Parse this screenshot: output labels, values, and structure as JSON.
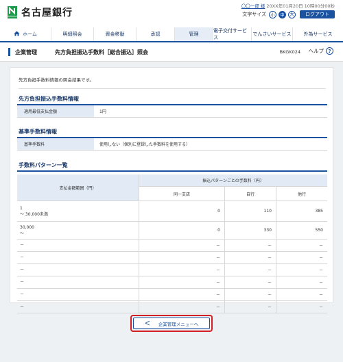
{
  "header": {
    "bank_name": "名古屋銀行",
    "user_name": "〇〇一郎 様",
    "login_datetime": "20XX年01月20日 10時00分00秒",
    "font_size_label": "文字サイズ",
    "font_sizes": [
      "小",
      "中",
      "大"
    ],
    "logout_label": "ログアウト"
  },
  "nav": {
    "items": [
      "ホーム",
      "明細照会",
      "資金移動",
      "承認",
      "管理",
      "電子交付サービス",
      "でんさいサービス",
      "外為サービス"
    ],
    "active": "管理"
  },
  "title": {
    "category": "企業管理",
    "main": "先方負担振込手数料［総合振込］照会",
    "screen_id": "BKGK024",
    "help_label": "ヘルプ",
    "help_icon_glyph": "?"
  },
  "intro_text": "先方負担手数料情報の照会結果です。",
  "section1": {
    "heading": "先方負担振込手数料情報",
    "key": "適用最低支払金額",
    "value": "1円"
  },
  "section2": {
    "heading": "基準手数料情報",
    "key": "基準手数料",
    "value": "使用しない（個別に登録した手数料を使用する）"
  },
  "section3": {
    "heading": "手数料パターン一覧",
    "range_header": "支払金額範囲（円）",
    "group_header": "振込パターンごとの手数料（円）",
    "col_headers": [
      "同一支店",
      "自行",
      "他行"
    ],
    "rows": [
      {
        "range1": "1",
        "range2": "～ 30,000未満",
        "c1": "0",
        "c2": "110",
        "c3": "385"
      },
      {
        "range1": "30,000",
        "range2": "～",
        "c1": "0",
        "c2": "330",
        "c3": "550"
      },
      {
        "range1": "－",
        "range2": "",
        "c1": "－",
        "c2": "－",
        "c3": "－"
      },
      {
        "range1": "－",
        "range2": "",
        "c1": "－",
        "c2": "－",
        "c3": "－"
      },
      {
        "range1": "－",
        "range2": "",
        "c1": "－",
        "c2": "－",
        "c3": "－"
      },
      {
        "range1": "－",
        "range2": "",
        "c1": "－",
        "c2": "－",
        "c3": "－"
      },
      {
        "range1": "－",
        "range2": "",
        "c1": "－",
        "c2": "－",
        "c3": "－"
      },
      {
        "range1": "－",
        "range2": "",
        "c1": "－",
        "c2": "－",
        "c3": "－"
      }
    ]
  },
  "back_button": {
    "label": "企業管理メニューへ",
    "icon_glyph": "＜"
  },
  "colors": {
    "brand": "#1a52a0",
    "highlight": "#d21e24",
    "logo_green": "#1e9a4a"
  }
}
